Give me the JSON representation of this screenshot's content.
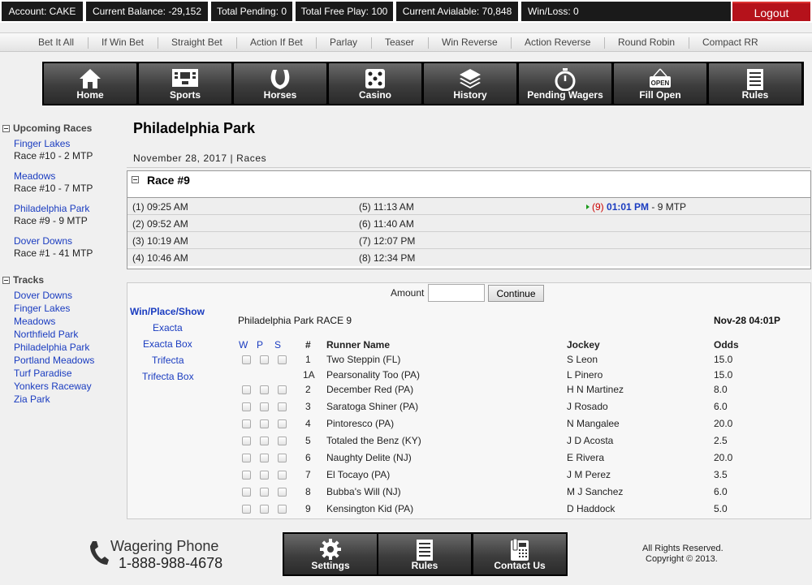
{
  "topbar": {
    "account": "Account: CAKE",
    "balance": "Current Balance: -29,152",
    "pending": "Total Pending: 0",
    "freeplay": "Total Free Play: 100",
    "available": "Current Avialable: 70,848",
    "winloss": "Win/Loss: 0",
    "logout": "Logout"
  },
  "betnav": [
    "Bet It All",
    "If Win Bet",
    "Straight Bet",
    "Action If Bet",
    "Parlay",
    "Teaser",
    "Win Reverse",
    "Action Reverse",
    "Round Robin",
    "Compact RR"
  ],
  "mainnav": [
    {
      "label": "Home",
      "icon": "home-icon"
    },
    {
      "label": "Sports",
      "icon": "scoreboard-icon"
    },
    {
      "label": "Horses",
      "icon": "horseshoe-icon"
    },
    {
      "label": "Casino",
      "icon": "dice-icon"
    },
    {
      "label": "History",
      "icon": "layers-icon"
    },
    {
      "label": "Pending Wagers",
      "icon": "stopwatch-icon"
    },
    {
      "label": "Fill Open",
      "icon": "open-sign-icon"
    },
    {
      "label": "Rules",
      "icon": "document-icon"
    }
  ],
  "sidebar": {
    "upcoming_title": "Upcoming Races",
    "upcoming": [
      {
        "track": "Finger Lakes",
        "race": "Race #10 - 2 MTP"
      },
      {
        "track": "Meadows",
        "race": "Race #10 - 7 MTP"
      },
      {
        "track": "Philadelphia Park",
        "race": "Race #9 - 9 MTP"
      },
      {
        "track": "Dover Downs",
        "race": "Race #1 - 41 MTP"
      }
    ],
    "tracks_title": "Tracks",
    "tracks": [
      "Dover Downs",
      "Finger Lakes",
      "Meadows",
      "Northfield Park",
      "Philadelphia Park",
      "Portland Meadows",
      "Turf Paradise",
      "Yonkers Raceway",
      "Zia Park"
    ]
  },
  "page": {
    "title": "Philadelphia Park",
    "date": "November 28, 2017 | Races"
  },
  "race_panel": {
    "title": "Race #9",
    "times": [
      [
        "(1) 09:25 AM",
        "(5) 11:13 AM"
      ],
      [
        "(2) 09:52 AM",
        "(6) 11:40 AM"
      ],
      [
        "(3) 10:19 AM",
        "(7) 12:07 PM"
      ],
      [
        "(4) 10:46 AM",
        "(8) 12:34 PM"
      ]
    ],
    "selected_num": "(9)",
    "selected_time": "01:01 PM",
    "selected_mtp": "- 9 MTP"
  },
  "wager": {
    "amount_label": "Amount",
    "amount_value": "",
    "continue": "Continue",
    "bet_types": [
      "Win/Place/Show",
      "Exacta",
      "Exacta Box",
      "Trifecta",
      "Trifecta Box"
    ],
    "race_info": "Philadelphia Park RACE 9",
    "race_datetime": "Nov-28 04:01P",
    "headers": {
      "w": "W",
      "p": "P",
      "s": "S",
      "num": "#",
      "runner": "Runner Name",
      "jockey": "Jockey",
      "odds": "Odds"
    },
    "runners": [
      {
        "num": "1",
        "name": "Two Steppin (FL)",
        "jockey": "S Leon",
        "odds": "15.0",
        "checkboxes": true
      },
      {
        "num": "1A",
        "name": "Pearsonality Too (PA)",
        "jockey": "L Pinero",
        "odds": "15.0",
        "checkboxes": false
      },
      {
        "num": "2",
        "name": "December Red (PA)",
        "jockey": "H N Martinez",
        "odds": "8.0",
        "checkboxes": true
      },
      {
        "num": "3",
        "name": "Saratoga Shiner (PA)",
        "jockey": "J Rosado",
        "odds": "6.0",
        "checkboxes": true
      },
      {
        "num": "4",
        "name": "Pintoresco (PA)",
        "jockey": "N Mangalee",
        "odds": "20.0",
        "checkboxes": true
      },
      {
        "num": "5",
        "name": "Totaled the Benz (KY)",
        "jockey": "J D Acosta",
        "odds": "2.5",
        "checkboxes": true
      },
      {
        "num": "6",
        "name": "Naughty Delite (NJ)",
        "jockey": "E Rivera",
        "odds": "20.0",
        "checkboxes": true
      },
      {
        "num": "7",
        "name": "El Tocayo (PA)",
        "jockey": "J M Perez",
        "odds": "3.5",
        "checkboxes": true
      },
      {
        "num": "8",
        "name": "Bubba's Will (NJ)",
        "jockey": "M J Sanchez",
        "odds": "6.0",
        "checkboxes": true
      },
      {
        "num": "9",
        "name": "Kensington Kid (PA)",
        "jockey": "D Haddock",
        "odds": "5.0",
        "checkboxes": true
      }
    ]
  },
  "footer": {
    "phone_label": "Wagering Phone",
    "phone_number": "1-888-988-4678",
    "nav": [
      {
        "label": "Settings",
        "icon": "gear-icon"
      },
      {
        "label": "Rules",
        "icon": "document-icon"
      },
      {
        "label": "Contact Us",
        "icon": "telephone-icon"
      }
    ],
    "rights": "All Rights Reserved.",
    "copyright": "Copyright © 2013."
  },
  "colors": {
    "accent_red": "#b5121b",
    "link_blue": "#1a3cc0",
    "bar_dark": "#1a1a1a"
  }
}
